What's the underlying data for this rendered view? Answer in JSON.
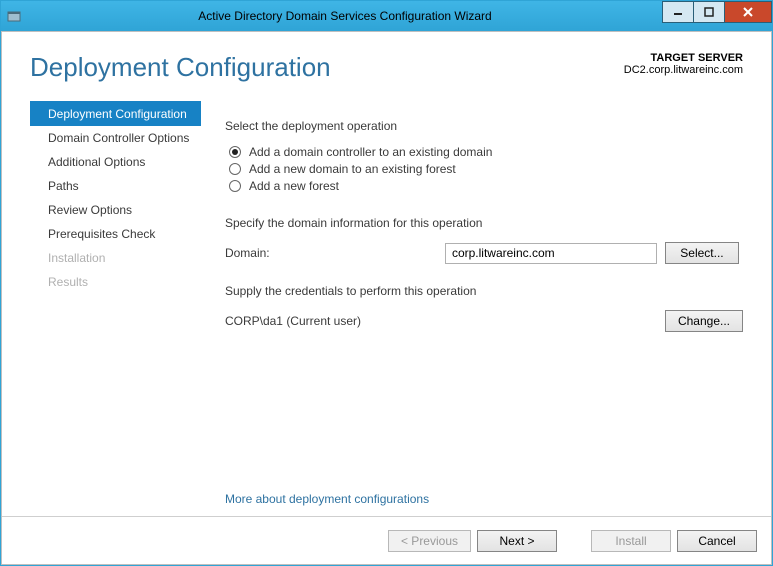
{
  "window": {
    "title": "Active Directory Domain Services Configuration Wizard"
  },
  "header": {
    "page_title": "Deployment Configuration",
    "target_label": "TARGET SERVER",
    "target_value": "DC2.corp.litwareinc.com"
  },
  "sidebar": {
    "items": [
      {
        "label": "Deployment Configuration",
        "active": true,
        "disabled": false
      },
      {
        "label": "Domain Controller Options",
        "active": false,
        "disabled": false
      },
      {
        "label": "Additional Options",
        "active": false,
        "disabled": false
      },
      {
        "label": "Paths",
        "active": false,
        "disabled": false
      },
      {
        "label": "Review Options",
        "active": false,
        "disabled": false
      },
      {
        "label": "Prerequisites Check",
        "active": false,
        "disabled": false
      },
      {
        "label": "Installation",
        "active": false,
        "disabled": true
      },
      {
        "label": "Results",
        "active": false,
        "disabled": true
      }
    ]
  },
  "panel": {
    "select_op_label": "Select the deployment operation",
    "radios": [
      {
        "label": "Add a domain controller to an existing domain",
        "checked": true
      },
      {
        "label": "Add a new domain to an existing forest",
        "checked": false
      },
      {
        "label": "Add a new forest",
        "checked": false
      }
    ],
    "specify_label": "Specify the domain information for this operation",
    "domain_label": "Domain:",
    "domain_value": "corp.litwareinc.com",
    "select_btn": "Select...",
    "creds_label": "Supply the credentials to perform this operation",
    "creds_value": "CORP\\da1 (Current user)",
    "change_btn": "Change...",
    "more_link": "More about deployment configurations"
  },
  "footer": {
    "previous": "< Previous",
    "next": "Next >",
    "install": "Install",
    "cancel": "Cancel"
  }
}
